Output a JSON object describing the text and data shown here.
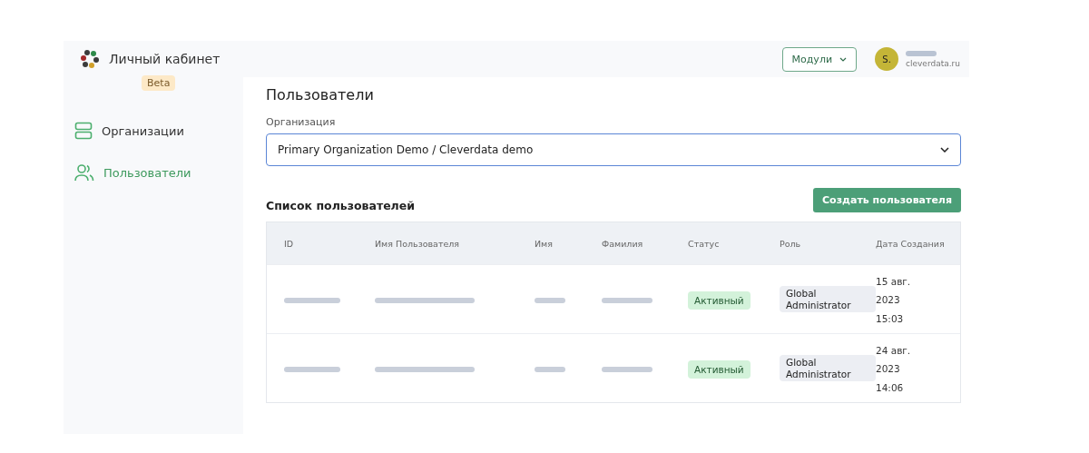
{
  "header": {
    "app_title": "Личный кабинет",
    "badge": "Beta",
    "modules_button": "Модули",
    "avatar": "S.",
    "account_domain": "cleverdata.ru"
  },
  "sidebar": {
    "items": [
      {
        "label": "Организации",
        "kind": "orgs",
        "selected": false
      },
      {
        "label": "Пользователи",
        "kind": "users",
        "selected": true
      }
    ]
  },
  "page": {
    "title": "Пользователи",
    "org_label": "Организация",
    "org_value": "Primary Organization Demo / Cleverdata demo",
    "list_title": "Список пользователей",
    "create_button": "Создать пользователя"
  },
  "table": {
    "columns": [
      "ID",
      "Имя Пользователя",
      "Имя",
      "Фамилия",
      "Статус",
      "Роль",
      "Дата Создания"
    ],
    "rows": [
      {
        "cells": [
          {
            "kind": "blurred"
          },
          {
            "kind": "blurred"
          },
          {
            "kind": "blurred"
          },
          {
            "kind": "blurred"
          },
          {
            "kind": "status",
            "text": "Активный"
          },
          {
            "kind": "role",
            "text": "Global Administrator"
          },
          {
            "kind": "date",
            "lines": [
              "15 авг.",
              "2023",
              "15:03"
            ]
          }
        ]
      },
      {
        "cells": [
          {
            "kind": "blurred"
          },
          {
            "kind": "blurred"
          },
          {
            "kind": "blurred"
          },
          {
            "kind": "blurred"
          },
          {
            "kind": "status",
            "text": "Активный"
          },
          {
            "kind": "role",
            "text": "Global Administrator"
          },
          {
            "kind": "date",
            "lines": [
              "24 авг.",
              "2023",
              "14:06"
            ]
          }
        ]
      }
    ]
  }
}
